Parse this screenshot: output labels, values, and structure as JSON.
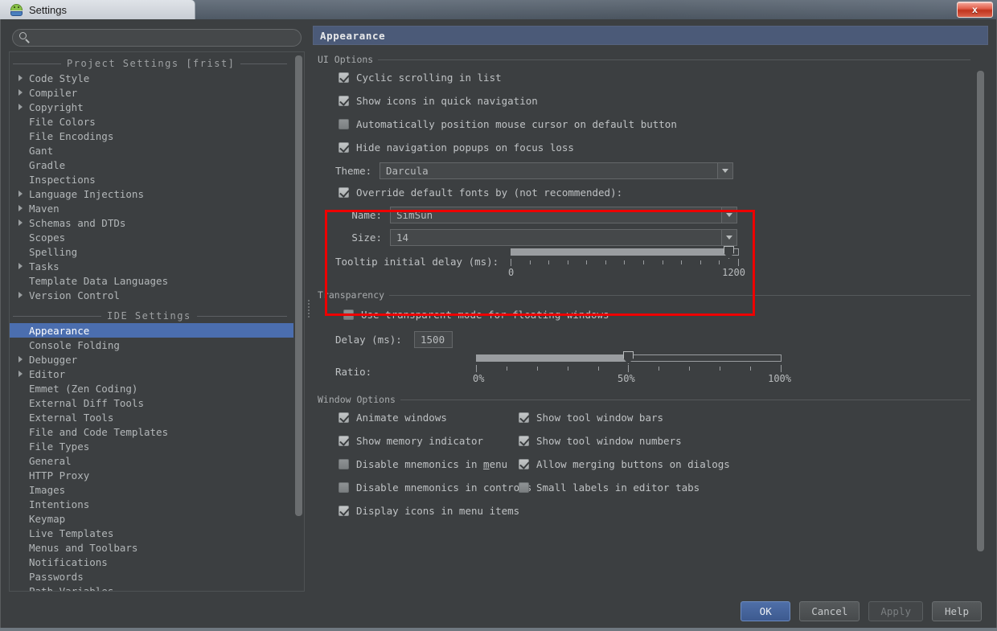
{
  "window": {
    "tab_title": "Settings",
    "app_icon": "android-robot-icon",
    "close_label": "x"
  },
  "search": {
    "value": "",
    "placeholder": "",
    "icon": "search-icon"
  },
  "sidebar": {
    "groups": [
      {
        "header": "Project Settings [frist]",
        "items": [
          {
            "label": "Code Style",
            "expandable": true,
            "selected": false
          },
          {
            "label": "Compiler",
            "expandable": true,
            "selected": false
          },
          {
            "label": "Copyright",
            "expandable": true,
            "selected": false
          },
          {
            "label": "File Colors",
            "expandable": false,
            "selected": false
          },
          {
            "label": "File Encodings",
            "expandable": false,
            "selected": false
          },
          {
            "label": "Gant",
            "expandable": false,
            "selected": false
          },
          {
            "label": "Gradle",
            "expandable": false,
            "selected": false
          },
          {
            "label": "Inspections",
            "expandable": false,
            "selected": false
          },
          {
            "label": "Language Injections",
            "expandable": true,
            "selected": false
          },
          {
            "label": "Maven",
            "expandable": true,
            "selected": false
          },
          {
            "label": "Schemas and DTDs",
            "expandable": true,
            "selected": false
          },
          {
            "label": "Scopes",
            "expandable": false,
            "selected": false
          },
          {
            "label": "Spelling",
            "expandable": false,
            "selected": false
          },
          {
            "label": "Tasks",
            "expandable": true,
            "selected": false
          },
          {
            "label": "Template Data Languages",
            "expandable": false,
            "selected": false
          },
          {
            "label": "Version Control",
            "expandable": true,
            "selected": false
          }
        ]
      },
      {
        "header": "IDE Settings",
        "items": [
          {
            "label": "Appearance",
            "expandable": false,
            "selected": true
          },
          {
            "label": "Console Folding",
            "expandable": false,
            "selected": false
          },
          {
            "label": "Debugger",
            "expandable": true,
            "selected": false
          },
          {
            "label": "Editor",
            "expandable": true,
            "selected": false
          },
          {
            "label": "Emmet (Zen Coding)",
            "expandable": false,
            "selected": false
          },
          {
            "label": "External Diff Tools",
            "expandable": false,
            "selected": false
          },
          {
            "label": "External Tools",
            "expandable": false,
            "selected": false
          },
          {
            "label": "File and Code Templates",
            "expandable": false,
            "selected": false
          },
          {
            "label": "File Types",
            "expandable": false,
            "selected": false
          },
          {
            "label": "General",
            "expandable": false,
            "selected": false
          },
          {
            "label": "HTTP Proxy",
            "expandable": false,
            "selected": false
          },
          {
            "label": "Images",
            "expandable": false,
            "selected": false
          },
          {
            "label": "Intentions",
            "expandable": false,
            "selected": false
          },
          {
            "label": "Keymap",
            "expandable": false,
            "selected": false
          },
          {
            "label": "Live Templates",
            "expandable": false,
            "selected": false
          },
          {
            "label": "Menus and Toolbars",
            "expandable": false,
            "selected": false
          },
          {
            "label": "Notifications",
            "expandable": false,
            "selected": false
          },
          {
            "label": "Passwords",
            "expandable": false,
            "selected": false
          },
          {
            "label": "Path Variables",
            "expandable": false,
            "selected": false
          }
        ]
      }
    ]
  },
  "panel": {
    "title": "Appearance",
    "ui_options": {
      "section_label": "UI Options",
      "checkboxes": [
        {
          "label": "Cyclic scrolling in list",
          "checked": true
        },
        {
          "label": "Show icons in quick navigation",
          "checked": true
        },
        {
          "label": "Automatically position mouse cursor on default button",
          "checked": false
        },
        {
          "label": "Hide navigation popups on focus loss",
          "checked": true
        }
      ],
      "theme_label": "Theme:",
      "theme_value": "Darcula",
      "override_fonts_label": "Override default fonts by (not recommended):",
      "override_fonts_checked": true,
      "font_name_label": "Name:",
      "font_name_value": "SimSun",
      "font_size_label": "Size:",
      "font_size_value": "14",
      "tooltip_delay_label": "Tooltip initial delay (ms):",
      "tooltip_delay_min": "0",
      "tooltip_delay_max": "1200",
      "tooltip_delay_value": 1200,
      "highlight_color": "#ee0000"
    },
    "transparency": {
      "section_label": "Transparency",
      "transparent_mode_label": "Use transparent mode for floating windows",
      "transparent_mode_checked": false,
      "delay_label": "Delay (ms):",
      "delay_value": "1500",
      "ratio_label": "Ratio:",
      "ratio_min": "0%",
      "ratio_mid": "50%",
      "ratio_max": "100%",
      "ratio_value": 50
    },
    "window_options": {
      "section_label": "Window Options",
      "left_column": [
        {
          "label": "Animate windows",
          "checked": true
        },
        {
          "label": "Show memory indicator",
          "checked": true
        },
        {
          "label": "Disable mnemonics in menu",
          "checked": false,
          "mnemonic": "m"
        },
        {
          "label": "Disable mnemonics in controls",
          "checked": false
        },
        {
          "label": "Display icons in menu items",
          "checked": true
        }
      ],
      "right_column": [
        {
          "label": "Show tool window bars",
          "checked": true
        },
        {
          "label": "Show tool window numbers",
          "checked": true
        },
        {
          "label": "Allow merging buttons on dialogs",
          "checked": true
        },
        {
          "label": "Small labels in editor tabs",
          "checked": false
        }
      ]
    }
  },
  "buttons": {
    "ok": "OK",
    "cancel": "Cancel",
    "apply": "Apply",
    "help": "Help",
    "apply_disabled": true
  },
  "colors": {
    "accent": "#4b6eaf",
    "panel_bg": "#3c3f41",
    "field_bg": "#45484a",
    "text": "#bfc2c4",
    "highlight": "#ee0000"
  }
}
